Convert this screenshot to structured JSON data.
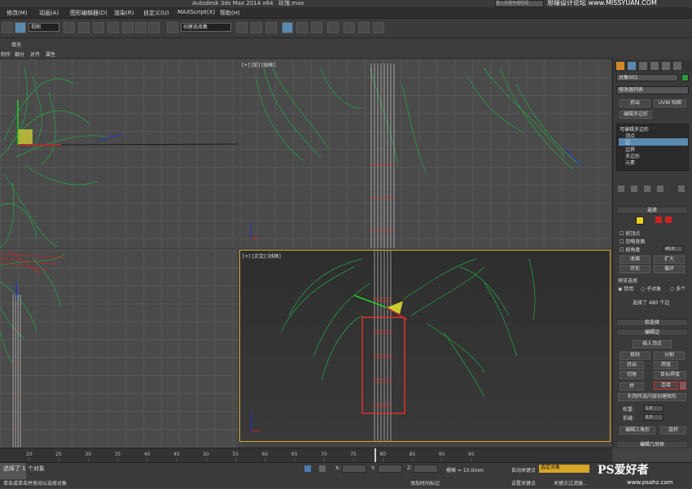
{
  "window": {
    "title": "Autodesk 3ds Max 2014 x64",
    "file": "玫瑰.max",
    "search_placeholder": "键入关键字或短语",
    "watermark": "思缘设计论坛 www.MISSYUAN.COM"
  },
  "menu": [
    "修改(M)",
    "动画(A)",
    "图形编辑器(D)",
    "渲染(R)",
    "自定义(U)",
    "MAXScript(X)",
    "帮助(H)"
  ],
  "toolbar": {
    "view_dropdown": "视图",
    "selection_set": "创建选择集"
  },
  "ribbon": {
    "fill_label": "填充",
    "tabs": [
      "制作",
      "细分",
      "对齐",
      "属性"
    ]
  },
  "viewports": {
    "top_right_label": "[+] [前] [线框]",
    "bottom_right_label": "[+] [正交] [线框]",
    "top_left_label": "",
    "bottom_left_label": ""
  },
  "command_panel": {
    "object_name": "对象001",
    "modifier_list": "修改器列表",
    "btn_extrude": "挤出",
    "btn_uvw": "UVW 贴图",
    "btn_edit_poly": "编辑多边形",
    "stack": {
      "root": "可编辑多边形",
      "items": [
        "顶点",
        "边",
        "边界",
        "多边形",
        "元素"
      ],
      "selected_index": 1
    },
    "selection": {
      "header": "选择",
      "by_vertex": "按顶点",
      "ignore_backface": "忽略背面",
      "by_angle": "按角度",
      "angle_value": "45.0",
      "shrink": "收缩",
      "grow": "扩大",
      "ring": "环形",
      "loop": "循环",
      "preview": "预览选择",
      "disable": "禁用",
      "sub_object": "子对象",
      "multi": "多个",
      "selected_count": "选择了 480 个边"
    },
    "soft_selection": "软选择",
    "edit_edges": {
      "header": "编辑边",
      "insert_vertex": "插入顶点",
      "remove": "移除",
      "split": "分割",
      "extrude": "挤出",
      "weld": "焊接",
      "chamfer": "切角",
      "target_weld": "目标焊接",
      "bridge": "桥",
      "connect": "连接",
      "create_shape": "利用所选内容创建图形",
      "weight_label": "权重:",
      "weight_value": "1.0",
      "crease_label": "折缝:",
      "crease_value": "0.0",
      "edit_tri": "编辑三角形",
      "rotate": "旋转"
    },
    "edit_geometry": "编辑几何体"
  },
  "timeline": {
    "ticks": [
      "20",
      "25",
      "30",
      "35",
      "40",
      "45",
      "50",
      "55",
      "60",
      "65",
      "70",
      "75",
      "80",
      "85",
      "90",
      "95"
    ]
  },
  "status": {
    "selected": "选择了 1 个对象",
    "hint": "单击或单击并拖动以选择对象",
    "add_time_tag": "添加时间标记",
    "x_label": "X:",
    "y_label": "Y:",
    "z_label": "Z:",
    "grid": "栅格 = 10.0mm",
    "auto_key": "自动关键点",
    "set_key": "设置关键点",
    "selected_obj": "选定对象",
    "key_filter": "关键点过滤器...",
    "brand": "PS爱好者",
    "brand_url": "www.psahz.com"
  }
}
